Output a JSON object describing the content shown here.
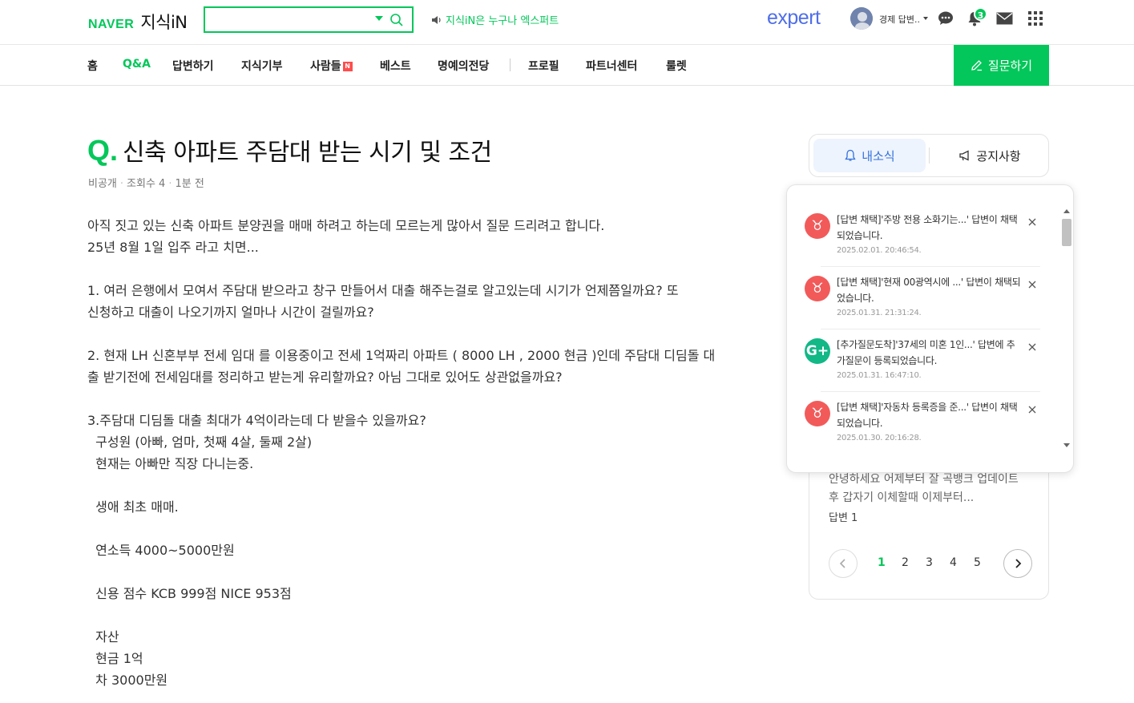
{
  "header": {
    "logo_naver": "NAVER",
    "logo_service": "지식iN",
    "search": {
      "value": "",
      "placeholder": ""
    },
    "notice_ticker": "지식iN은 누구나 엑스퍼트",
    "expert_logo": "expert",
    "user_name": "경제 답변..",
    "bell_badge_count": "3"
  },
  "nav": {
    "items": [
      {
        "label": "홈"
      },
      {
        "label": "Q&A",
        "active": true
      },
      {
        "label": "답변하기"
      },
      {
        "label": "지식기부"
      },
      {
        "label": "사람들",
        "badge": "N"
      },
      {
        "label": "베스트"
      },
      {
        "label": "명예의전당"
      },
      {
        "label": "프로필"
      },
      {
        "label": "파트너센터"
      },
      {
        "label": "룰렛"
      }
    ],
    "ask_button": "질문하기"
  },
  "question": {
    "q_mark": "Q.",
    "title": "신축 아파트 주담대 받는 시기 및 조건",
    "meta": {
      "author": "비공개",
      "views": "조회수 4",
      "time": "1분 전"
    },
    "body_lines": [
      "아직 짓고 있는 신축 아파트 분양권을 매매 하려고 하는데 모르는게 많아서 질문 드리려고 합니다.",
      "25년 8월 1일 입주 라고 치면...",
      "",
      "1. 여러 은행에서 모여서 주담대 받으라고 창구 만들어서 대출 해주는걸로 알고있는데 시기가 언제쯤일까요? 또",
      "신청하고 대출이 나오기까지 얼마나 시간이 걸릴까요?",
      "",
      "2. 현재 LH 신혼부부 전세 임대 를 이용중이고 전세 1억짜리 아파트 ( 8000 LH , 2000 현금 )인데 주담대 디딤돌 대",
      "출 받기전에 전세임대를 정리하고 받는게 유리할까요? 아님 그대로 있어도 상관없을까요?",
      "",
      "3.주담대 디딤돌 대출 최대가 4억이라는데 다 받을수 있을까요?",
      "  구성원 (아빠, 엄마, 첫째 4살, 둘째 2살)",
      "  현재는 아빠만 직장 다니는중.",
      "",
      "  생애 최초 매매.",
      "",
      "  연소득 4000~5000만원",
      "",
      "  신용 점수 KCB 999점 NICE 953점",
      "",
      "  자산",
      "  현금 1억",
      "  차 3000만원"
    ]
  },
  "sidebar": {
    "tab_mynews": "내소식",
    "tab_notice": "공지사항",
    "card": {
      "preview": "안녕하세요 어제부터 잘 곡뱅크 업데이트 후 갑자기 이체할때 이제부터...",
      "answer_count": "답변 1",
      "pages": [
        "1",
        "2",
        "3",
        "4",
        "5"
      ],
      "current_page": "1"
    }
  },
  "notifications": [
    {
      "icon": "red",
      "symbol": "♉",
      "text": "[답변 채택]'주방 전용 소화기는...' 답변이 채택되었습니다.",
      "time": "2025.02.01. 20:46:54."
    },
    {
      "icon": "red",
      "symbol": "♉",
      "text": "[답변 채택]'현재 00광역시에 ...' 답변이 채택되었습니다.",
      "time": "2025.01.31. 21:31:24."
    },
    {
      "icon": "green",
      "symbol": "G+",
      "text": "[추가질문도착]'37세의 미혼 1인...' 답변에 추가질문이 등록되었습니다.",
      "time": "2025.01.31. 16:47:10."
    },
    {
      "icon": "red",
      "symbol": "♉",
      "text": "[답변 채택]'자동차 등록증을 준...' 답변이 채택되었습니다.",
      "time": "2025.01.30. 20:16:28."
    }
  ],
  "colors": {
    "brand_green": "#03c75a",
    "expert_blue": "#4f6ee8",
    "tab_blue": "#3370dd",
    "notif_red": "#f25a5a",
    "notif_green": "#12b886"
  }
}
